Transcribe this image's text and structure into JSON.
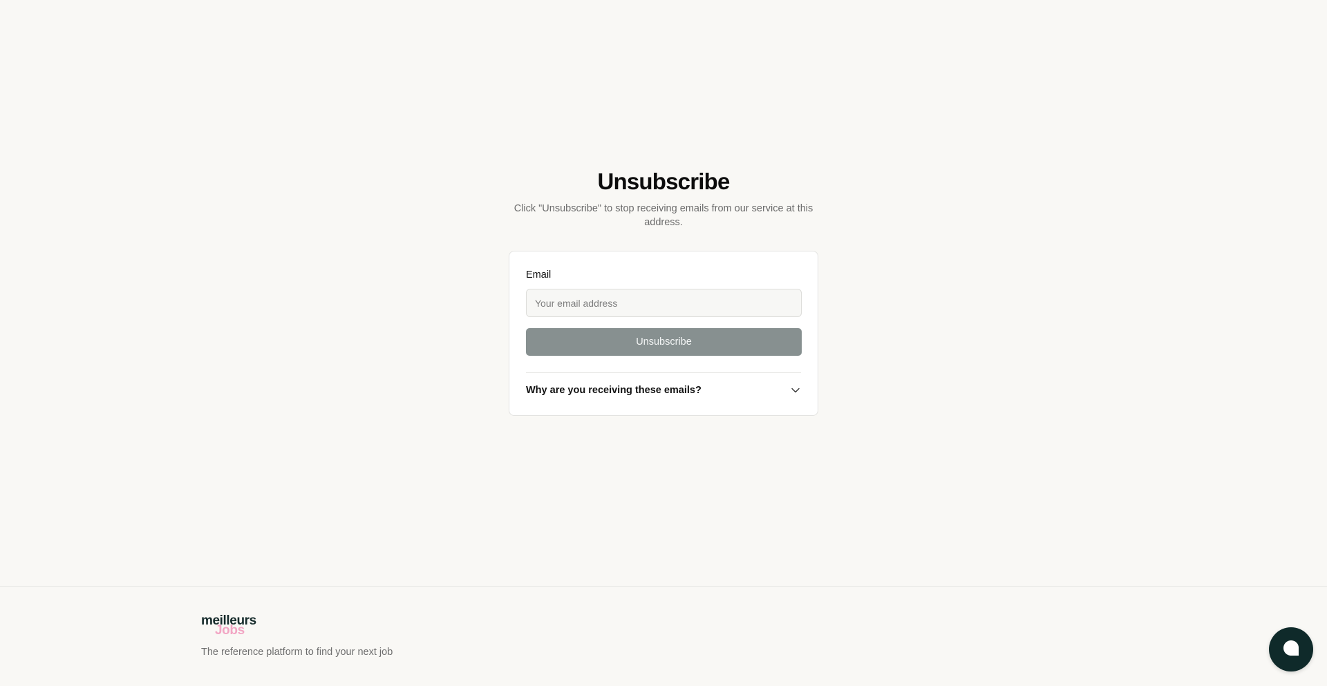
{
  "page": {
    "title": "Unsubscribe",
    "subtitle": "Click \"Unsubscribe\" to stop receiving emails from our service at this address."
  },
  "form": {
    "email_label": "Email",
    "email_placeholder": "Your email address",
    "email_value": "",
    "submit_label": "Unsubscribe",
    "faq_question": "Why are you receiving these emails?"
  },
  "footer": {
    "logo_top": "meilleurs",
    "logo_bottom": "Jobs",
    "tagline": "The reference platform to find your next job"
  },
  "icons": {
    "faq_toggle": "chevron-down-icon",
    "chat": "chat-bubble-icon"
  },
  "colors": {
    "background": "#f9f8f5",
    "button": "#879090",
    "brand_dark": "#0f2a2a",
    "brand_pink": "#f2a6c4"
  }
}
